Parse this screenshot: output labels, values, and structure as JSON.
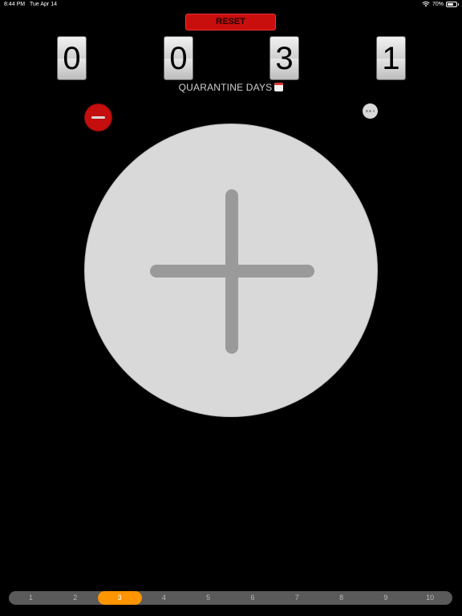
{
  "status_bar": {
    "time": "8:44 PM",
    "date": "Tue Apr 14",
    "battery_percent_label": "70%",
    "battery_level": 0.7
  },
  "reset": {
    "label": "RESET"
  },
  "counter": {
    "digits": [
      "0",
      "0",
      "3",
      "1"
    ]
  },
  "caption": {
    "text": "QUARANTINE DAYS",
    "icon": "calendar-icon"
  },
  "controls": {
    "minus_icon": "minus-icon",
    "more_icon": "ellipsis-icon",
    "plus_icon": "plus-icon"
  },
  "page_selector": {
    "items": [
      "1",
      "2",
      "3",
      "4",
      "5",
      "6",
      "7",
      "8",
      "9",
      "10"
    ],
    "selected": "3"
  },
  "colors": {
    "background": "#000000",
    "reset": "#c90e0e",
    "minus": "#c50e0e",
    "plus_circle": "#d9d9d9",
    "plus_sign": "#9a9a9a",
    "selector_track": "#5a5a5a",
    "selector_active": "#ff9500"
  }
}
